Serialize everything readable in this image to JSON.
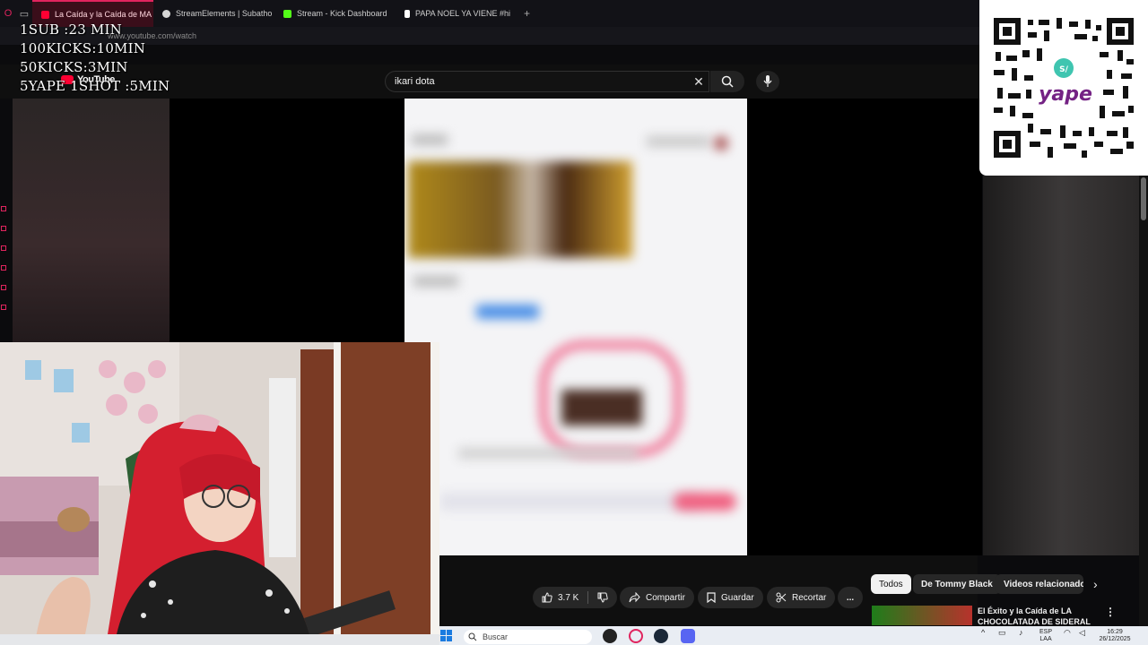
{
  "browser": {
    "tabs": [
      {
        "label": "La Caída y la Caída de MA",
        "active": true,
        "favicon_color": "#ff0033"
      },
      {
        "label": "StreamElements | Subatho",
        "active": false,
        "favicon_color": "#d6d6d6"
      },
      {
        "label": "Stream - Kick Dashboard",
        "active": false,
        "favicon_color": "#53fc18"
      },
      {
        "label": "PAPA NOEL YA VIENE #hi",
        "active": false,
        "favicon_color": "#ffffff"
      }
    ],
    "new_tab": "+",
    "address": "www.youtube.com/watch"
  },
  "overlay": {
    "lines": [
      "1SUB :23 MIN",
      "100KICKS:10MIN",
      "50KICKS:3MIN",
      "5YAPE 1SHOT :5MIN"
    ]
  },
  "youtube": {
    "logo": "YouTube",
    "search_value": "ikari dota",
    "actions": {
      "likes": "3.7 K",
      "share": "Compartir",
      "save": "Guardar",
      "clip": "Recortar",
      "more": "..."
    },
    "chips": [
      "Todos",
      "De Tommy Black",
      "Videos relacionados"
    ],
    "related_title": "El Éxito y la Caída de LA CHOCOLATADA DE SIDERAL"
  },
  "qr": {
    "brand": "yape",
    "badge": "S/"
  },
  "taskbar": {
    "search_placeholder": "Buscar",
    "lang": "ESP",
    "lang_sub": "LAA",
    "time": "16:29",
    "date": "26/12/2025"
  },
  "colors": {
    "accent": "#e0245e",
    "yape": "#742284"
  }
}
